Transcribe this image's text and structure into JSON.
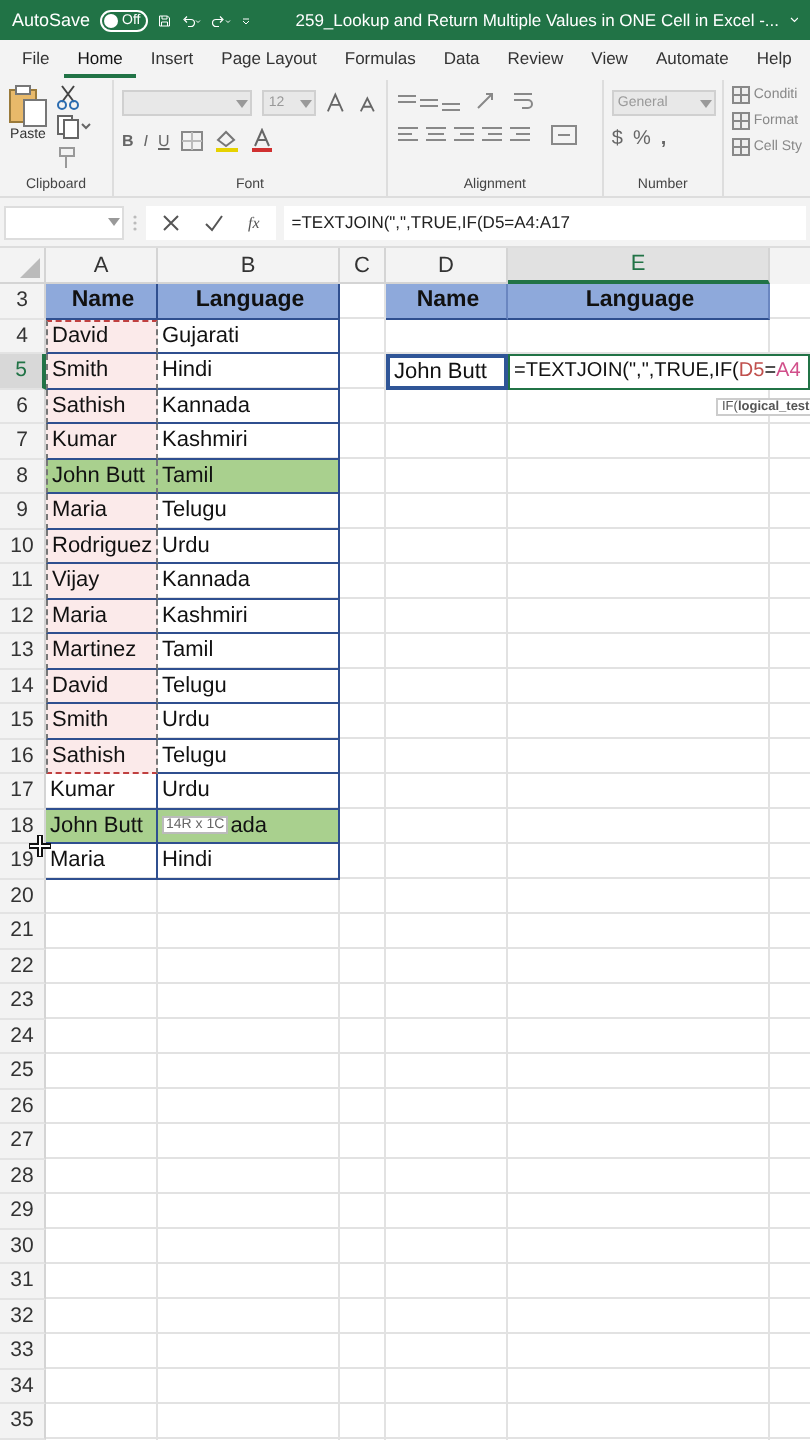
{
  "title_bar": {
    "autosave_label": "AutoSave",
    "autosave": {
      "label": "Off",
      "on": false
    },
    "title": "259_Lookup and Return Multiple Values in ONE Cell in Excel -..."
  },
  "tabs": [
    {
      "label": "File",
      "selected": false
    },
    {
      "label": "Home",
      "selected": true
    },
    {
      "label": "Insert",
      "selected": false
    },
    {
      "label": "Page Layout",
      "selected": false
    },
    {
      "label": "Formulas",
      "selected": false
    },
    {
      "label": "Data",
      "selected": false
    },
    {
      "label": "Review",
      "selected": false
    },
    {
      "label": "View",
      "selected": false
    },
    {
      "label": "Automate",
      "selected": false
    },
    {
      "label": "Help",
      "selected": false
    }
  ],
  "ribbon": {
    "clipboard": {
      "paste": "Paste",
      "label": "Clipboard"
    },
    "font": {
      "size": "12",
      "bold": "B",
      "italic": "I",
      "underline": "U",
      "label": "Font"
    },
    "alignment": {
      "label": "Alignment"
    },
    "number": {
      "format": "General",
      "currency": "$",
      "percent": "%",
      "comma": ",",
      "label": "Number"
    },
    "styles": [
      "Conditi",
      "Format",
      "Cell Sty"
    ]
  },
  "formula_bar": {
    "fx": "fx",
    "formula": "=TEXTJOIN(\",\",TRUE,IF(D5=A4:A17"
  },
  "columns": [
    {
      "label": "A",
      "selected": false
    },
    {
      "label": "B",
      "selected": false
    },
    {
      "label": "C",
      "selected": false
    },
    {
      "label": "D",
      "selected": false
    },
    {
      "label": "E",
      "selected": true
    }
  ],
  "rows": [
    {
      "number": "3",
      "selected": false
    },
    {
      "number": "4",
      "selected": false
    },
    {
      "number": "5",
      "selected": true
    },
    {
      "number": "6",
      "selected": false
    },
    {
      "number": "7",
      "selected": false
    },
    {
      "number": "8",
      "selected": false
    },
    {
      "number": "9",
      "selected": false
    },
    {
      "number": "10",
      "selected": false
    },
    {
      "number": "11",
      "selected": false
    },
    {
      "number": "12",
      "selected": false
    },
    {
      "number": "13",
      "selected": false
    },
    {
      "number": "14",
      "selected": false
    },
    {
      "number": "15",
      "selected": false
    },
    {
      "number": "16",
      "selected": false
    },
    {
      "number": "17",
      "selected": false
    },
    {
      "number": "18",
      "selected": false
    },
    {
      "number": "19",
      "selected": false
    },
    {
      "number": "20",
      "selected": false
    },
    {
      "number": "21",
      "selected": false
    },
    {
      "number": "22",
      "selected": false
    },
    {
      "number": "23",
      "selected": false
    },
    {
      "number": "24",
      "selected": false
    },
    {
      "number": "25",
      "selected": false
    },
    {
      "number": "26",
      "selected": false
    },
    {
      "number": "27",
      "selected": false
    },
    {
      "number": "28",
      "selected": false
    },
    {
      "number": "29",
      "selected": false
    },
    {
      "number": "30",
      "selected": false
    },
    {
      "number": "31",
      "selected": false
    },
    {
      "number": "32",
      "selected": false
    },
    {
      "number": "33",
      "selected": false
    },
    {
      "number": "34",
      "selected": false
    },
    {
      "number": "35",
      "selected": false
    }
  ],
  "table": {
    "headers": [
      "Name",
      "Language"
    ],
    "rows": [
      {
        "name": "David",
        "language": "Gujarati",
        "highlighted": false,
        "copied": true
      },
      {
        "name": "Smith",
        "language": "Hindi",
        "highlighted": false,
        "copied": true
      },
      {
        "name": "Sathish",
        "language": "Kannada",
        "highlighted": false,
        "copied": true
      },
      {
        "name": "Kumar",
        "language": "Kashmiri",
        "highlighted": false,
        "copied": true
      },
      {
        "name": "John Butt",
        "language": "Tamil",
        "highlighted": true,
        "copied": true
      },
      {
        "name": "Maria",
        "language": "Telugu",
        "highlighted": false,
        "copied": true
      },
      {
        "name": "Rodriguez",
        "language": "Urdu",
        "highlighted": false,
        "copied": true
      },
      {
        "name": "Vijay",
        "language": "Kannada",
        "highlighted": false,
        "copied": true
      },
      {
        "name": "Maria",
        "language": "Kashmiri",
        "highlighted": false,
        "copied": true
      },
      {
        "name": "Martinez",
        "language": "Tamil",
        "highlighted": false,
        "copied": true
      },
      {
        "name": "David",
        "language": "Telugu",
        "highlighted": false,
        "copied": true
      },
      {
        "name": "Smith",
        "language": "Urdu",
        "highlighted": false,
        "copied": true
      },
      {
        "name": "Sathish",
        "language": "Telugu",
        "highlighted": false,
        "copied": true
      },
      {
        "name": "Kumar",
        "language": "Urdu",
        "highlighted": false,
        "copied": false
      },
      {
        "name": "John Butt",
        "language": "ada",
        "tooltip": "14R x 1C",
        "highlighted": true,
        "copied": false
      },
      {
        "name": "Maria",
        "language": "Hindi",
        "highlighted": false,
        "copied": false
      }
    ]
  },
  "lookup": {
    "headers": [
      "Name",
      "Language"
    ],
    "name": "John Butt",
    "formula": [
      {
        "kind": "text",
        "text": "=TEXTJOIN(\",\",TRUE,IF("
      },
      {
        "kind": "reference",
        "text": "D5",
        "color": "#c0504d"
      },
      {
        "kind": "text",
        "text": "="
      },
      {
        "kind": "reference",
        "text": "A4",
        "color": "#d14f8a"
      }
    ],
    "tip": "IF(**logical_test**"
  }
}
